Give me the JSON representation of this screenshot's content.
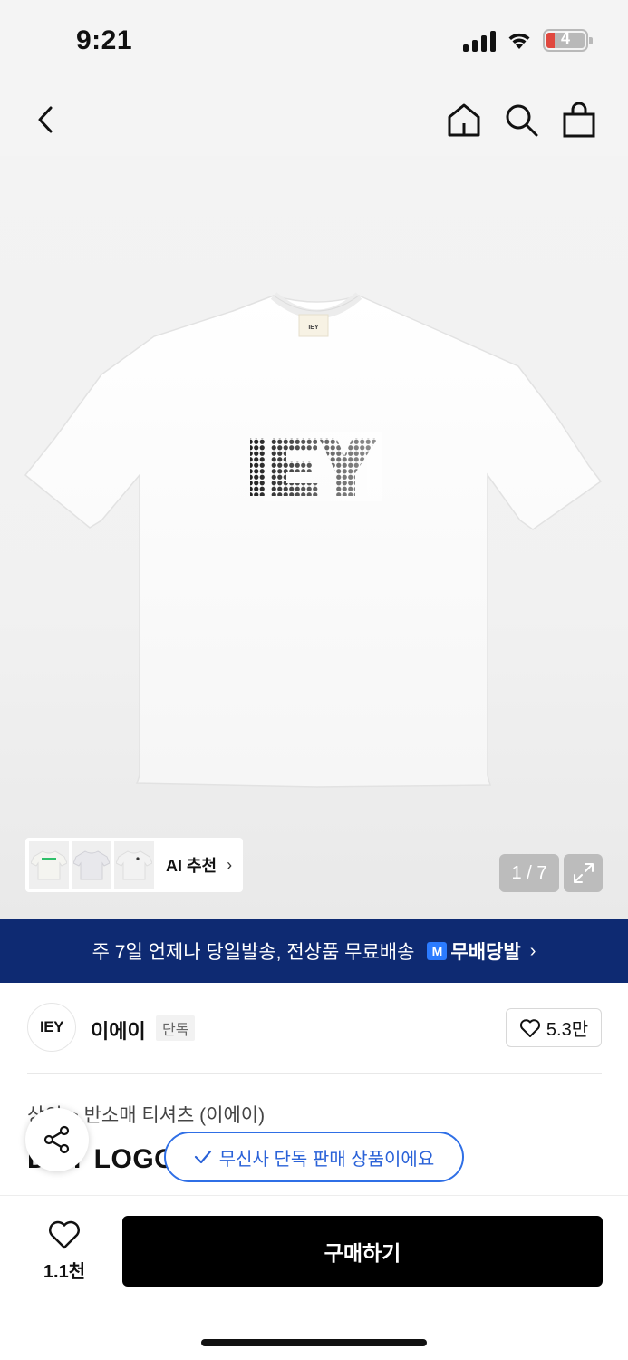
{
  "status_bar": {
    "time": "9:21",
    "battery": "4"
  },
  "nav": {
    "back_icon": "chevron-left-icon",
    "home_icon": "home-icon",
    "search_icon": "search-icon",
    "cart_icon": "shopping-bag-icon"
  },
  "hero": {
    "label_text": "IEY",
    "print_text": "IEY",
    "ai_label": "AI 추천",
    "counter": "1 / 7",
    "expand_icon": "expand-icon"
  },
  "banner": {
    "text": "주 7일 언제나 당일발송, 전상품 무료배송",
    "badge_logo": "M",
    "badge_text": "무배당발",
    "color": "#0e2a72"
  },
  "brand": {
    "logo_text": "IEY",
    "name": "이에이",
    "tag": "단독",
    "likes": "5.3만"
  },
  "product": {
    "category": "상의 > 반소매 티셔츠 (이에이)",
    "title": "DOT LOGO T-SHIRT",
    "exclusive_tip": "무신사 단독 판매 상품이에요"
  },
  "bottom": {
    "wish_count": "1.1천",
    "buy_label": "구매하기"
  },
  "colors": {
    "accent_blue": "#2f6fe6",
    "buy_button": "#000000"
  }
}
